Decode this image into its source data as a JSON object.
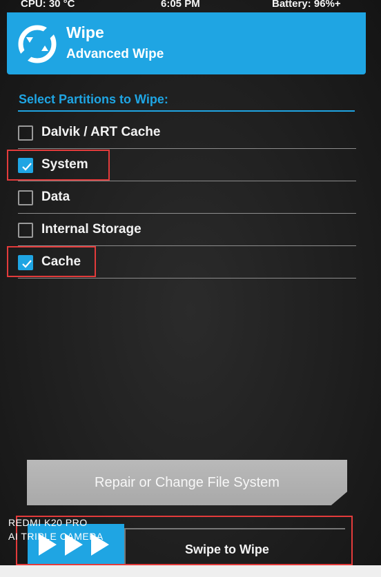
{
  "status_bar": {
    "cpu": "CPU: 30 °C",
    "time": "6:05 PM",
    "battery": "Battery: 96%+"
  },
  "header": {
    "title": "Wipe",
    "subtitle": "Advanced Wipe",
    "logo_icon": "twrp-logo-icon"
  },
  "partitions": {
    "title": "Select Partitions to Wipe:",
    "items": [
      {
        "label": "Dalvik / ART Cache",
        "checked": false
      },
      {
        "label": "System",
        "checked": true
      },
      {
        "label": "Data",
        "checked": false
      },
      {
        "label": "Internal Storage",
        "checked": false
      },
      {
        "label": "Cache",
        "checked": true
      }
    ]
  },
  "actions": {
    "repair_label": "Repair or Change File System",
    "swipe_label": "Swipe to Wipe",
    "swipe_icon": "triple-arrow-icon"
  },
  "watermark": {
    "line1": "REDMI K20 PRO",
    "line2": "AI TRIPLE CAMERA"
  },
  "colors": {
    "accent": "#1fa5e3",
    "background": "#1f1f1f",
    "highlight": "#e43b3b",
    "button": "#b0b0b0"
  }
}
